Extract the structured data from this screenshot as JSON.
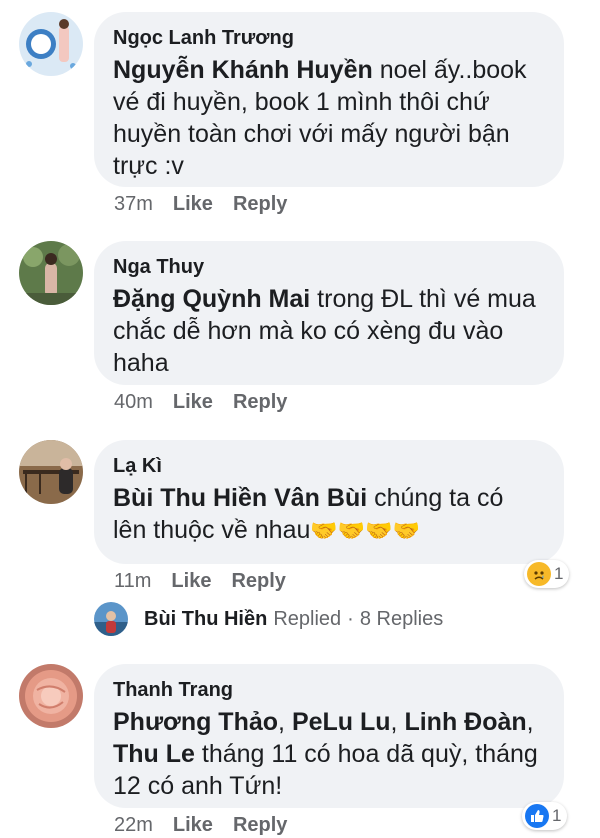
{
  "comments": [
    {
      "author": "Ngọc Lanh Trương",
      "mention": "Nguyễn Khánh Huyền",
      "text": " noel ấy..book vé đi huyền, book 1 mình thôi chứ huyền toàn chơi với mấy người bận trực :v",
      "time": "37m",
      "like": "Like",
      "reply": "Reply"
    },
    {
      "author": "Nga Thuy",
      "mention": "Đặng Quỳnh Mai",
      "text": " trong ĐL thì vé mua chắc dễ hơn mà ko có xèng đu vào haha",
      "time": "40m",
      "like": "Like",
      "reply": "Reply"
    },
    {
      "author": "Lạ Kì",
      "mention": "Bùi Thu Hiền Vân Bùi",
      "text": " chúng ta có lên thuộc về nhau",
      "emoji": "🤝🤝🤝🤝",
      "time": "11m",
      "like": "Like",
      "reply": "Reply",
      "reaction": {
        "icon": "sad-icon",
        "count": "1"
      },
      "replies": {
        "name": "Bùi Thu Hiền",
        "replied": "Replied",
        "sep": "·",
        "count": "8 Replies"
      }
    },
    {
      "author": "Thanh Trang",
      "mention1": "Phương Thảo",
      "mention2": "PeLu Lu",
      "mention3": "Linh Đoàn",
      "mention4": "Thu Le",
      "sep": ", ",
      "text": " tháng 11 có hoa dã quỳ, tháng 12 có anh Tứn!",
      "time": "22m",
      "like": "Like",
      "reply": "Reply",
      "reaction": {
        "icon": "thumbs-up-icon",
        "count": "1"
      }
    }
  ],
  "colors": {
    "bubble": "#f0f2f5",
    "meta": "#65676b",
    "like_blue": "#1877f2"
  }
}
